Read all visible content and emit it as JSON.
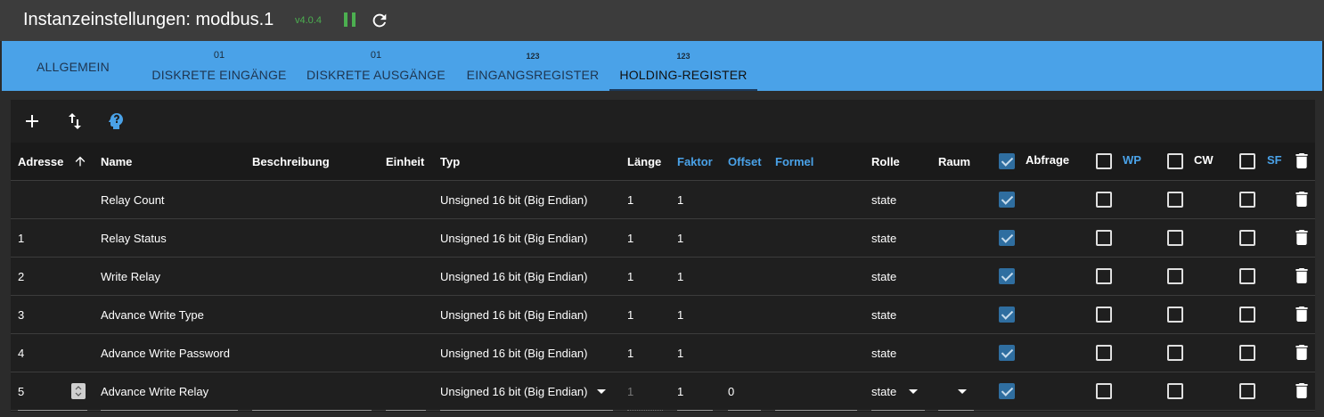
{
  "header": {
    "title": "Instanzeinstellungen: modbus.1",
    "version": "v4.0.4"
  },
  "tabs": [
    {
      "badge": "",
      "label": "ALLGEMEIN"
    },
    {
      "badge": "01",
      "label": "DISKRETE EINGÄNGE"
    },
    {
      "badge": "01",
      "label": "DISKRETE AUSGÄNGE"
    },
    {
      "badge": "123",
      "label": "EINGANGSREGISTER"
    },
    {
      "badge": "123",
      "label": "HOLDING-REGISTER"
    }
  ],
  "active_tab": "HOLDING-REGISTER",
  "columns": {
    "address": "Adresse",
    "name": "Name",
    "description": "Beschreibung",
    "unit": "Einheit",
    "type": "Typ",
    "length": "Länge",
    "factor": "Faktor",
    "offset": "Offset",
    "formula": "Formel",
    "role": "Rolle",
    "room": "Raum",
    "poll": "Abfrage",
    "wp": "WP",
    "cw": "CW",
    "sf": "SF"
  },
  "rows": [
    {
      "address": "",
      "name": "Relay Count",
      "type": "Unsigned 16 bit (Big Endian)",
      "length": "1",
      "factor": "1",
      "role": "state"
    },
    {
      "address": "1",
      "name": "Relay Status",
      "type": "Unsigned 16 bit (Big Endian)",
      "length": "1",
      "factor": "1",
      "role": "state"
    },
    {
      "address": "2",
      "name": "Write Relay",
      "type": "Unsigned 16 bit (Big Endian)",
      "length": "1",
      "factor": "1",
      "role": "state"
    },
    {
      "address": "3",
      "name": "Advance Write Type",
      "type": "Unsigned 16 bit (Big Endian)",
      "length": "1",
      "factor": "1",
      "role": "state"
    },
    {
      "address": "4",
      "name": "Advance Write Password",
      "type": "Unsigned 16 bit (Big Endian)",
      "length": "1",
      "factor": "1",
      "role": "state"
    }
  ],
  "edit_row": {
    "address": "5",
    "name": "Advance Write Relay",
    "type": "Unsigned 16 bit (Big Endian)",
    "length": "1",
    "factor": "1",
    "offset": "0",
    "role": "state"
  },
  "colors": {
    "accent": "#4aa2e8",
    "version": "#4caf50",
    "checkbox_checked": "#2f6ea0"
  },
  "icons": {
    "add": "plus-icon",
    "sort": "swap-vertical-icon",
    "ai": "head-icon",
    "pause": "pause-icon",
    "refresh": "refresh-icon",
    "delete": "trash-icon",
    "sort_asc": "arrow-up-icon"
  }
}
